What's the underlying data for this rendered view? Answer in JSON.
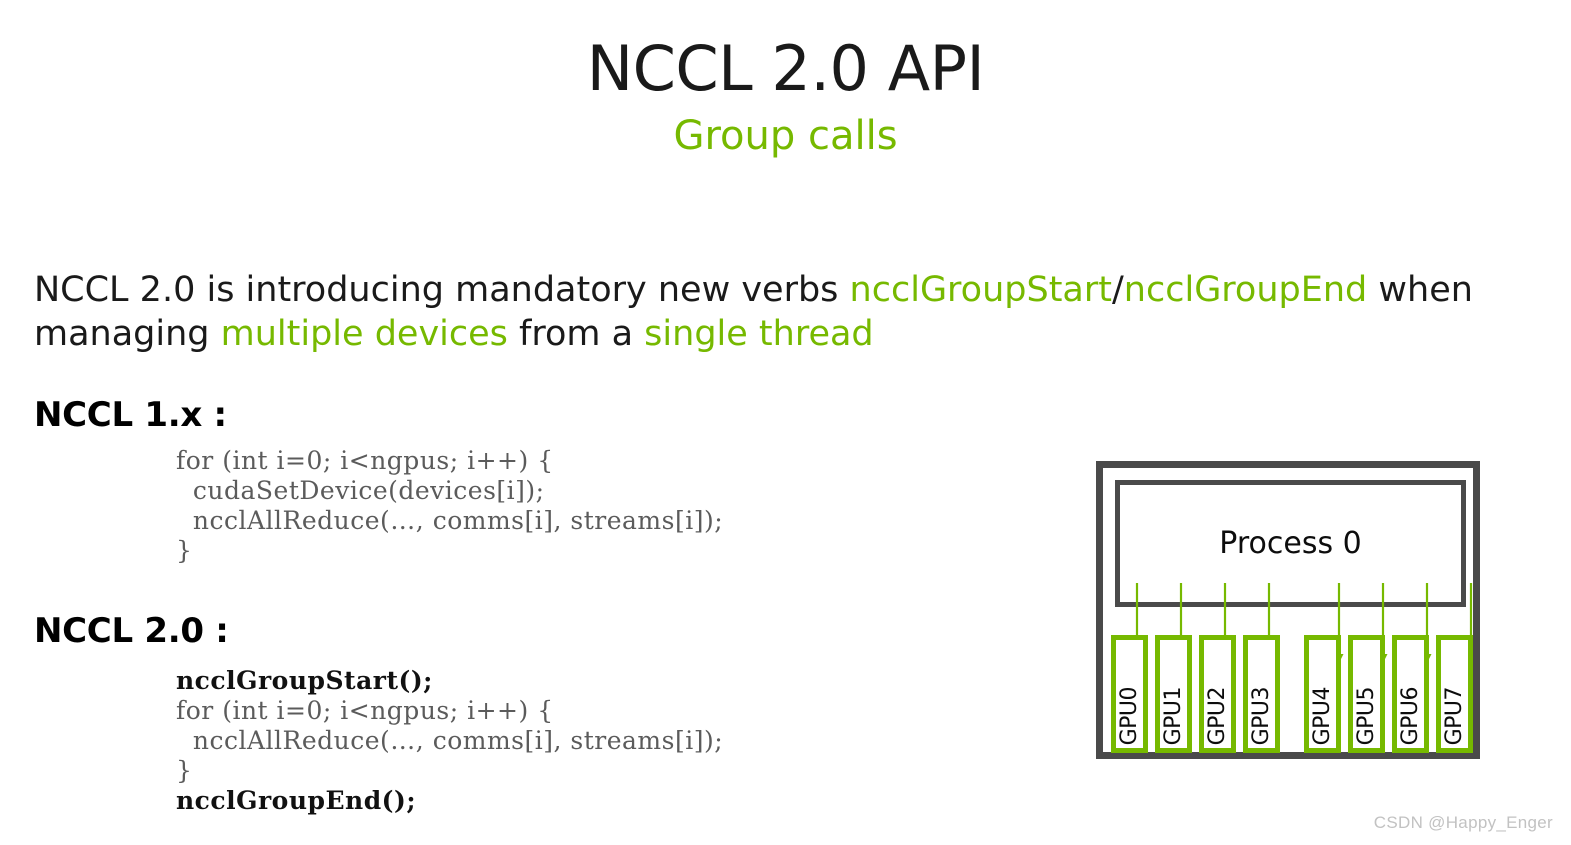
{
  "slide": {
    "title": "NCCL 2.0 API",
    "subtitle": "Group calls",
    "accent_color": "#76b900",
    "text_color": "#1a1a1a",
    "box_color": "#4a4a4a"
  },
  "intro": {
    "seg1": "NCCL 2.0 is introducing mandatory new verbs ",
    "seg2_accent": "ncclGroupStart",
    "seg3": "/",
    "seg4_accent": "ncclGroupEnd",
    "seg5": " when managing ",
    "seg6_accent": "multiple devices",
    "seg7": " from a ",
    "seg8_accent": "single thread"
  },
  "sections": {
    "nccl1_heading": "NCCL 1.x :",
    "nccl2_heading": "NCCL 2.0 :"
  },
  "code_nccl1": {
    "line1": "for (int i=0; i<ngpus; i++) {",
    "line2": "  cudaSetDevice(devices[i]);",
    "line3": "  ncclAllReduce(…, comms[i], streams[i]);",
    "line4": "}"
  },
  "code_nccl2": {
    "line1_strong": "ncclGroupStart();",
    "line2": "for (int i=0; i<ngpus; i++) {",
    "line3": "  ncclAllReduce(…, comms[i], streams[i]);",
    "line4": "}",
    "line5_strong": "ncclGroupEnd();"
  },
  "diagram": {
    "process_label": "Process 0",
    "gpus_group_a": [
      "GPU0",
      "GPU1",
      "GPU2",
      "GPU3"
    ],
    "gpus_group_b": [
      "GPU4",
      "GPU5",
      "GPU6",
      "GPU7"
    ]
  },
  "watermark": {
    "text": "CSDN @Happy_Enger"
  }
}
